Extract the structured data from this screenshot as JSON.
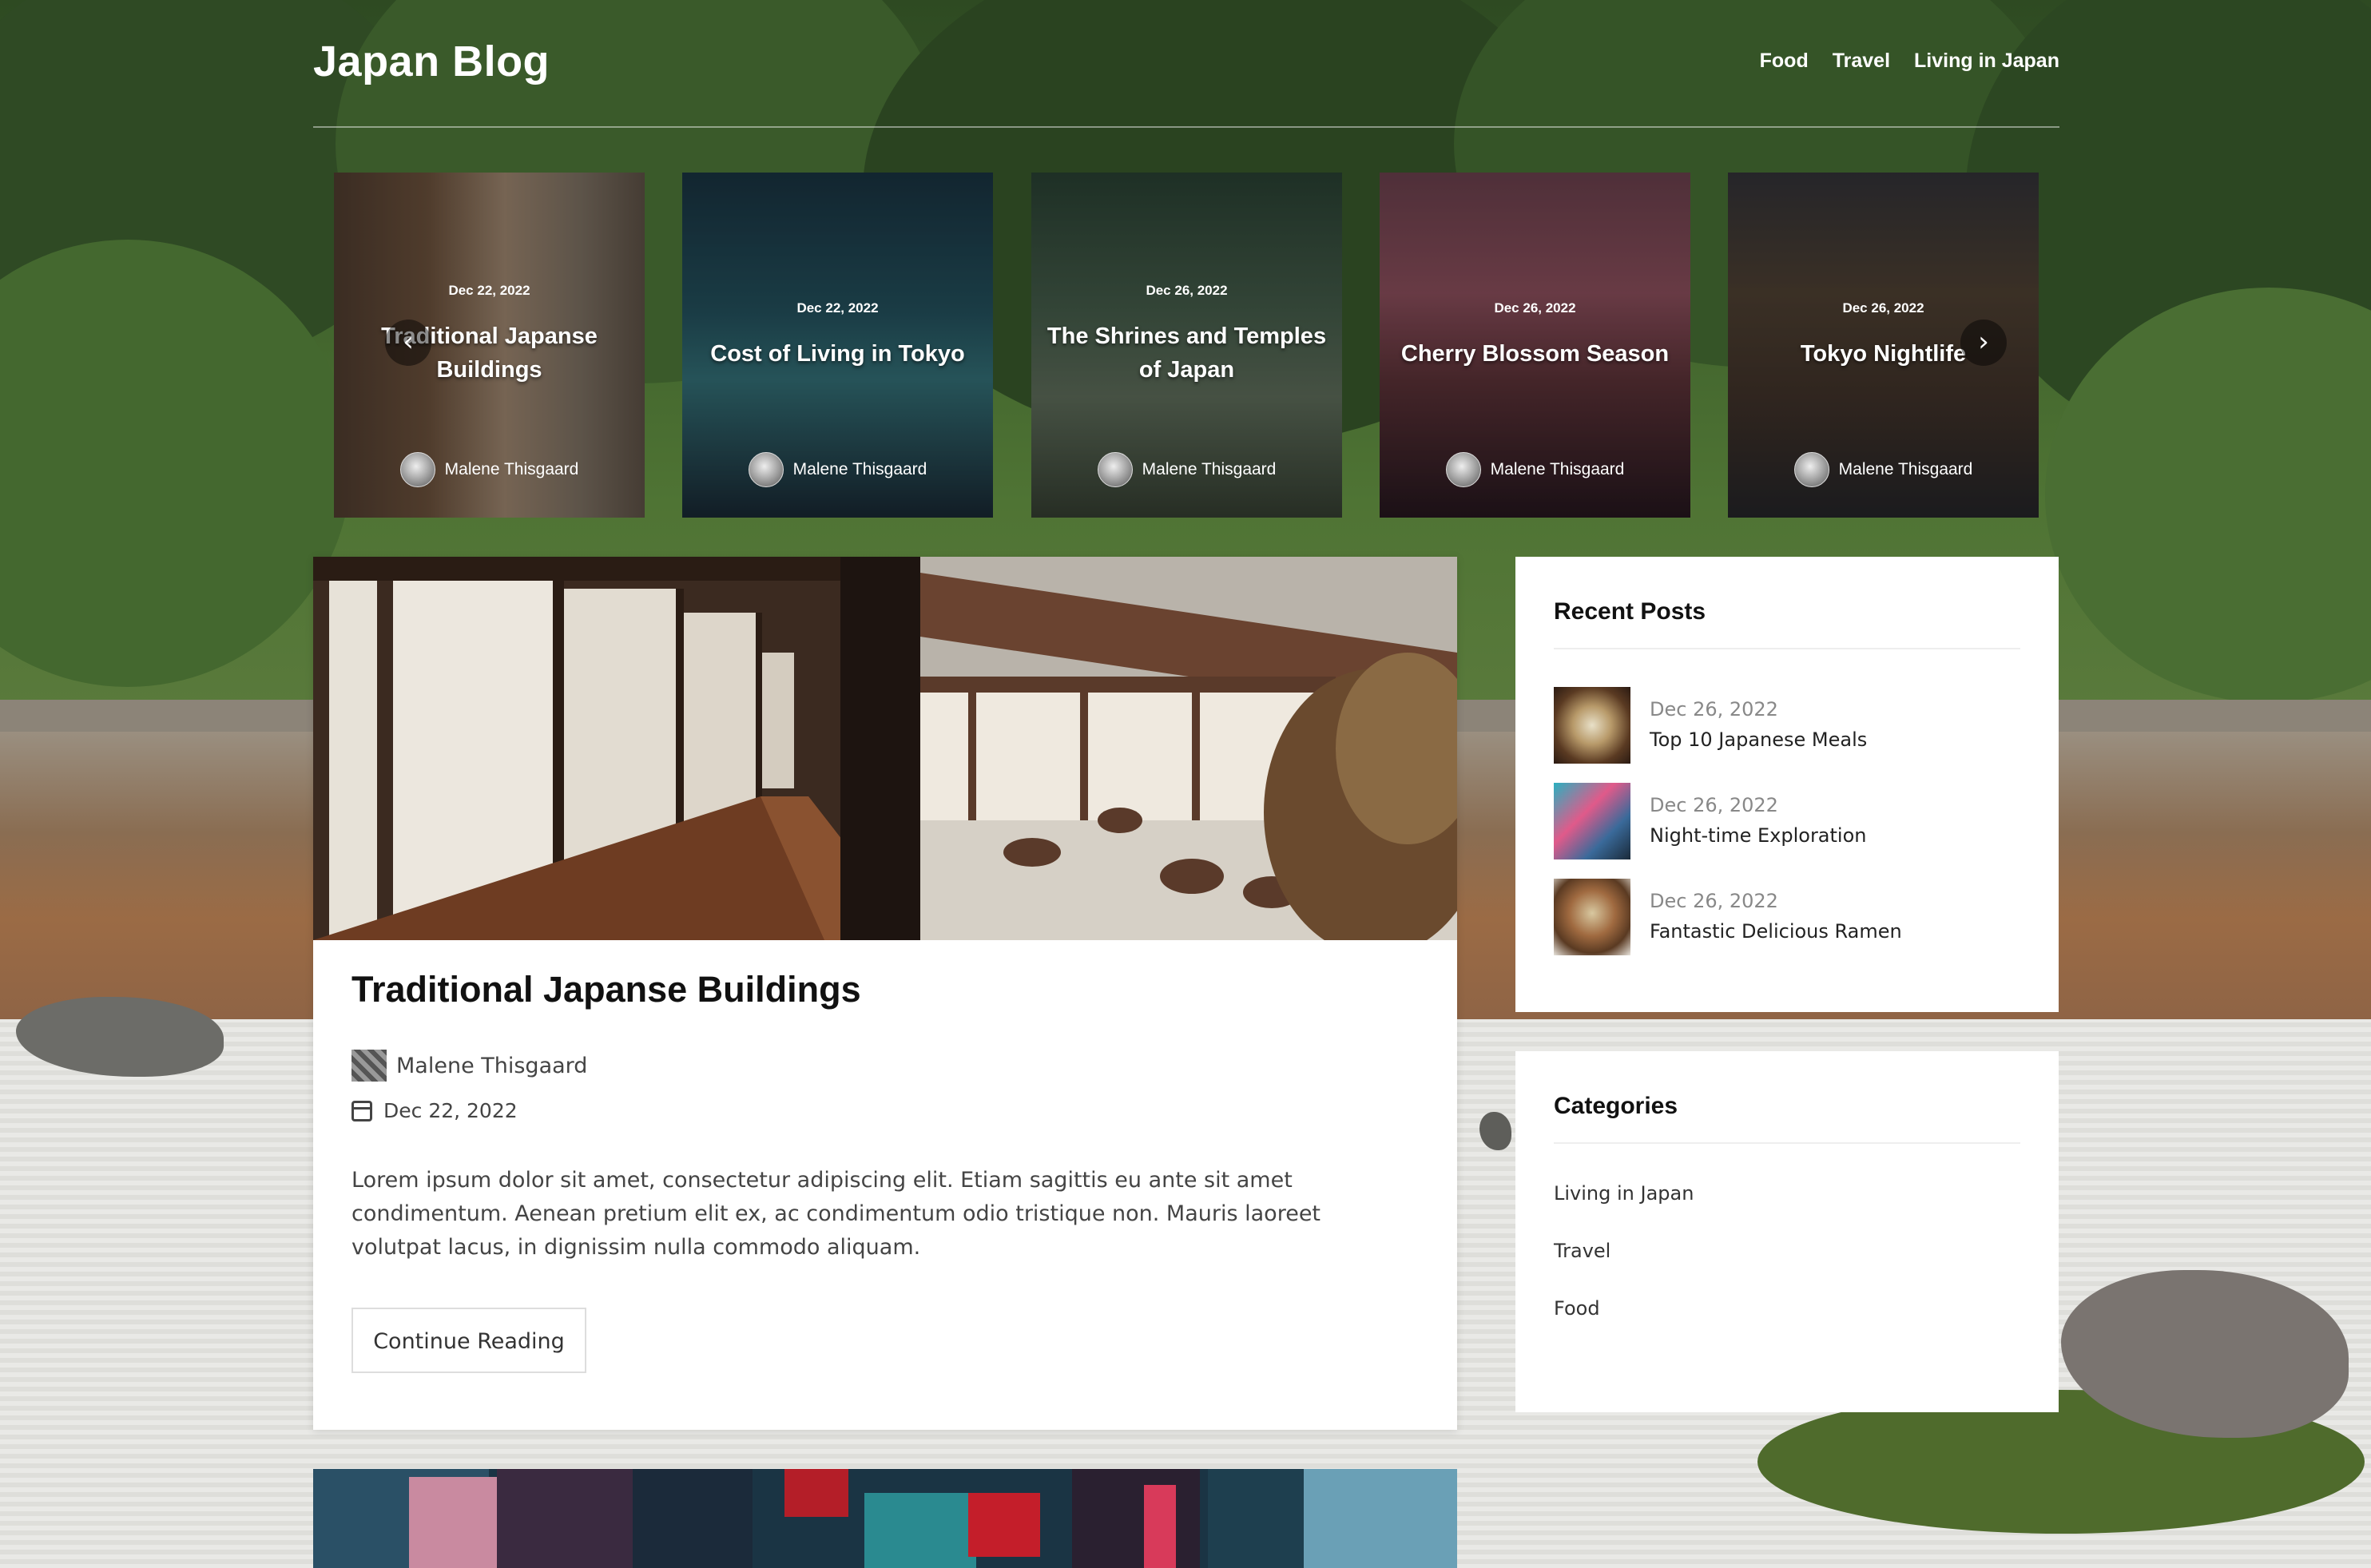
{
  "site": {
    "title": "Japan Blog"
  },
  "nav": [
    "Food",
    "Travel",
    "Living in Japan"
  ],
  "carousel": {
    "slides": [
      {
        "date": "Dec 22, 2022",
        "title": "Traditional Japanse Buildings",
        "author": "Malene Thisgaard"
      },
      {
        "date": "Dec 22, 2022",
        "title": "Cost of Living in Tokyo",
        "author": "Malene Thisgaard"
      },
      {
        "date": "Dec 26, 2022",
        "title": "The Shrines and Temples of Japan",
        "author": "Malene Thisgaard"
      },
      {
        "date": "Dec 26, 2022",
        "title": "Cherry Blossom Season",
        "author": "Malene Thisgaard"
      },
      {
        "date": "Dec 26, 2022",
        "title": "Tokyo Nightlife",
        "author": "Malene Thisgaard"
      }
    ],
    "prev_icon": "chevron-left-icon",
    "next_icon": "chevron-right-icon"
  },
  "post": {
    "title": "Traditional Japanse Buildings",
    "author": "Malene Thisgaard",
    "date": "Dec 22, 2022",
    "excerpt": "Lorem ipsum dolor sit amet, consectetur adipiscing elit. Etiam sagittis eu ante sit amet condimentum. Aenean pretium elit ex, ac condimentum odio tristique non. Mauris laoreet volutpat lacus, in dignissim nulla commodo aliquam.",
    "button": "Continue Reading",
    "date_icon": "calendar-icon"
  },
  "sidebar": {
    "recent": {
      "heading": "Recent Posts",
      "items": [
        {
          "date": "Dec 26, 2022",
          "title": "Top 10 Japanese Meals"
        },
        {
          "date": "Dec 26, 2022",
          "title": "Night-time Exploration"
        },
        {
          "date": "Dec 26, 2022",
          "title": "Fantastic Delicious Ramen"
        }
      ]
    },
    "categories": {
      "heading": "Categories",
      "items": [
        "Living in Japan",
        "Travel",
        "Food"
      ]
    }
  }
}
